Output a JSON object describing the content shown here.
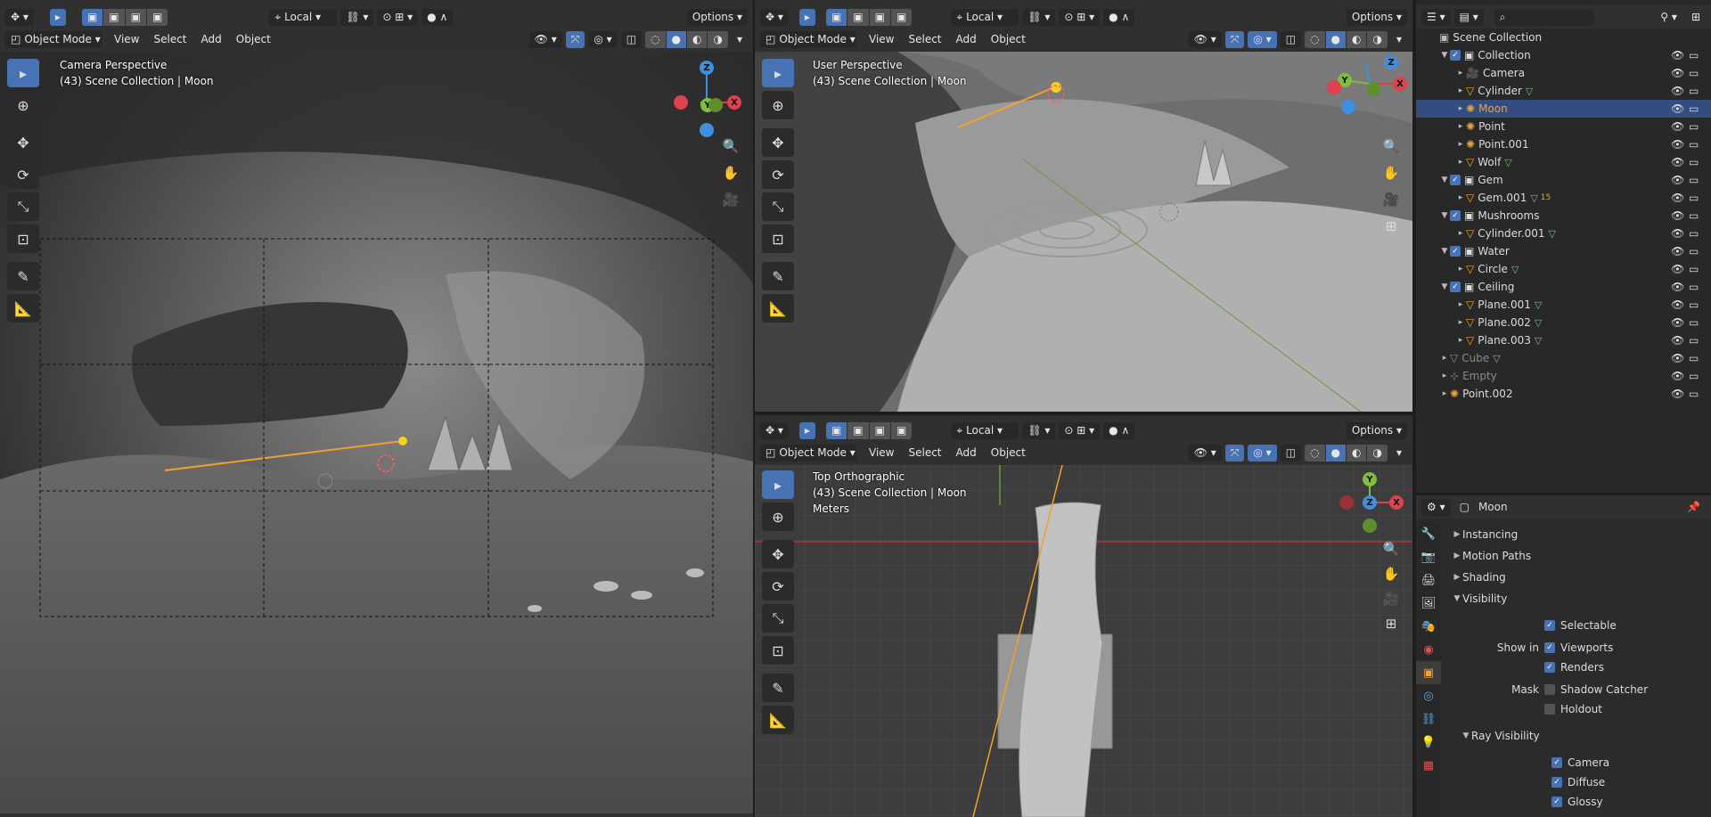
{
  "viewport_common": {
    "mode": "Object Mode",
    "menus": [
      "View",
      "Select",
      "Add",
      "Object"
    ],
    "transform": "Local",
    "options": "Options"
  },
  "left_viewport": {
    "title": "Camera Perspective",
    "subtitle": "(43) Scene Collection | Moon"
  },
  "top_right_viewport": {
    "title": "User Perspective",
    "subtitle": "(43) Scene Collection | Moon"
  },
  "bottom_right_viewport": {
    "title": "Top Orthographic",
    "subtitle": "(43) Scene Collection | Moon",
    "units": "Meters"
  },
  "gizmo": {
    "x": "X",
    "y": "Y",
    "z": "Z"
  },
  "outliner": {
    "root": "Scene Collection",
    "rows": [
      {
        "name": "Collection",
        "type": "collection",
        "depth": 1
      },
      {
        "name": "Camera",
        "type": "camera",
        "depth": 2
      },
      {
        "name": "Cylinder",
        "type": "mesh",
        "depth": 2
      },
      {
        "name": "Moon",
        "type": "light",
        "depth": 2,
        "selected": true
      },
      {
        "name": "Point",
        "type": "light",
        "depth": 2
      },
      {
        "name": "Point.001",
        "type": "light",
        "depth": 2
      },
      {
        "name": "Wolf",
        "type": "mesh",
        "depth": 2
      },
      {
        "name": "Gem",
        "type": "collection",
        "depth": 1
      },
      {
        "name": "Gem.001",
        "type": "mesh",
        "depth": 2,
        "badge": "15"
      },
      {
        "name": "Mushrooms",
        "type": "collection",
        "depth": 1
      },
      {
        "name": "Cylinder.001",
        "type": "mesh",
        "depth": 2
      },
      {
        "name": "Water",
        "type": "collection",
        "depth": 1
      },
      {
        "name": "Circle",
        "type": "mesh",
        "depth": 2
      },
      {
        "name": "Ceiling",
        "type": "collection",
        "depth": 1
      },
      {
        "name": "Plane.001",
        "type": "mesh",
        "depth": 2
      },
      {
        "name": "Plane.002",
        "type": "mesh",
        "depth": 2
      },
      {
        "name": "Plane.003",
        "type": "mesh",
        "depth": 2
      },
      {
        "name": "Cube",
        "type": "mesh",
        "depth": 1,
        "dim": true
      },
      {
        "name": "Empty",
        "type": "empty",
        "depth": 1,
        "dim": true
      },
      {
        "name": "Point.002",
        "type": "light",
        "depth": 1
      }
    ]
  },
  "properties": {
    "object_name": "Moon",
    "panels": [
      "Instancing",
      "Motion Paths",
      "Shading",
      "Visibility"
    ],
    "selectable": "Selectable",
    "show_in": "Show in",
    "viewports": "Viewports",
    "renders": "Renders",
    "mask": "Mask",
    "shadow_catcher": "Shadow Catcher",
    "holdout": "Holdout",
    "ray_visibility": "Ray Visibility",
    "camera": "Camera",
    "diffuse": "Diffuse",
    "glossy": "Glossy"
  },
  "colors": {
    "accent": "#4772b3",
    "selected_row": "#334d80",
    "axis_x": "#e0414f",
    "axis_y": "#7fbf3f",
    "axis_z": "#3f8fe0"
  }
}
